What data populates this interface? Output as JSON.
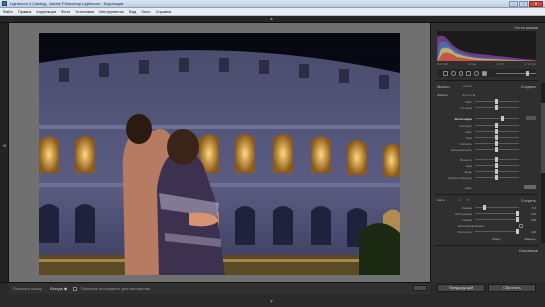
{
  "window": {
    "title": "Lightroom 4 Catalog - Adobe Photoshop Lightroom - Коррекция",
    "minimize": "–",
    "maximize": "□",
    "close": "✕"
  },
  "menu": [
    "Файл",
    "Правка",
    "Коррекция",
    "Фото",
    "Установки",
    "Инструменты",
    "Вид",
    "Окно",
    "Справка"
  ],
  "right_panel": {
    "histogram": {
      "title": "Гистограмма",
      "info": [
        "ISO 200",
        "22 мм",
        "f / 4,5",
        "1/ 10 сек"
      ]
    },
    "basic_header": {
      "mask": "Маска :",
      "new": "Новая",
      "edit": "Создать"
    },
    "effect": {
      "label": "Эффект :",
      "preset": "Экспоз ◆"
    },
    "rows_top": [
      {
        "label": "Темп",
        "value": ""
      },
      {
        "label": "Оттенок",
        "value": ""
      }
    ],
    "exposure": {
      "label": "Экспозиция",
      "value": ""
    },
    "rows_mid": [
      {
        "label": "Контраст",
        "value": ""
      },
      {
        "label": "Свет",
        "value": ""
      },
      {
        "label": "Тени",
        "value": ""
      },
      {
        "label": "Четкость",
        "value": ""
      },
      {
        "label": "Насыщенность",
        "value": ""
      }
    ],
    "rows_lower": [
      {
        "label": "Резкость",
        "value": ""
      },
      {
        "label": "Шум",
        "value": ""
      },
      {
        "label": "Муар",
        "value": ""
      },
      {
        "label": "Удалить бахрому",
        "value": ""
      }
    ],
    "color": {
      "label": "Цвет"
    },
    "brush": {
      "label": "Кисть :",
      "a": "A",
      "b": "B",
      "erase": "Стереть",
      "rows": [
        {
          "label": "Размер",
          "value": "5,0"
        },
        {
          "label": "Растушевка",
          "value": "100"
        },
        {
          "label": "Нажим",
          "value": "100"
        },
        {
          "label": "Плотность",
          "value": "100"
        }
      ],
      "automask": "Автомаскирование",
      "reset": "Сброс",
      "close": "Закрыть"
    },
    "tone_curve": "Основные",
    "buttons": {
      "previous": "Предыдущий",
      "reset": "Сбросить"
    }
  },
  "toolbar": {
    "show_mask": "Показать маску :",
    "mask_mode": "Всегда ◆",
    "auto_overlay": "Показать инструмент для наложения"
  },
  "colors": {
    "accent": "#c8c8c8",
    "panel": "#2f2f2f",
    "canvas": "#707070"
  }
}
